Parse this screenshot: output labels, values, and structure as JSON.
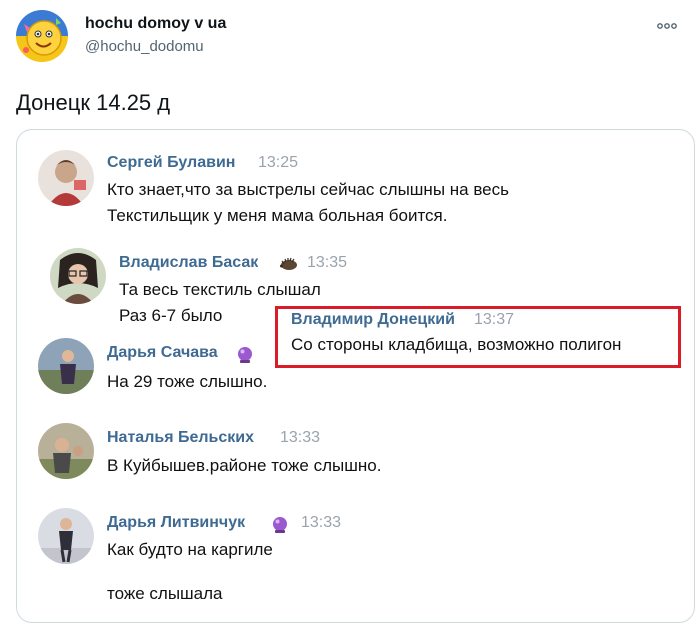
{
  "author": {
    "display_name": "hochu domoy v ua",
    "handle": "@hochu_dodomu"
  },
  "tweet": {
    "text": "Донецк 14.25 д"
  },
  "icons": {
    "more": "more-dots-icon",
    "badge": "crystal-ball-icon",
    "hedgehog": "hedgehog-icon"
  },
  "colors": {
    "name_blue": "#3f6b93",
    "time_gray": "#9aa3ad",
    "highlight_red": "#d91c28",
    "card_border": "#cfd9de"
  },
  "messages": [
    {
      "name": "Сергей Булавин",
      "time": "13:25",
      "lines": [
        "Кто знает,что за выстрелы сейчас слышны на весь",
        "Текстильщик у меня мама больная боится."
      ]
    },
    {
      "name": "Владислав Басак",
      "time": "13:35",
      "lines": [
        "Та весь текстиль слышал",
        "Раз 6-7 было"
      ]
    },
    {
      "name": "Владимир Донецкий",
      "time": "13:37",
      "lines": [
        "Со стороны кладбища, возможно полигон"
      ]
    },
    {
      "name": "Дарья Сачава",
      "time": "",
      "lines": [
        "На 29 тоже слышно."
      ]
    },
    {
      "name": "Наталья Бельских",
      "time": "13:33",
      "lines": [
        "В Куйбышев.районе тоже слышно."
      ]
    },
    {
      "name": "Дарья Литвинчук",
      "time": "13:33",
      "lines": [
        "Как будто на каргиле",
        "тоже слышала"
      ]
    }
  ]
}
